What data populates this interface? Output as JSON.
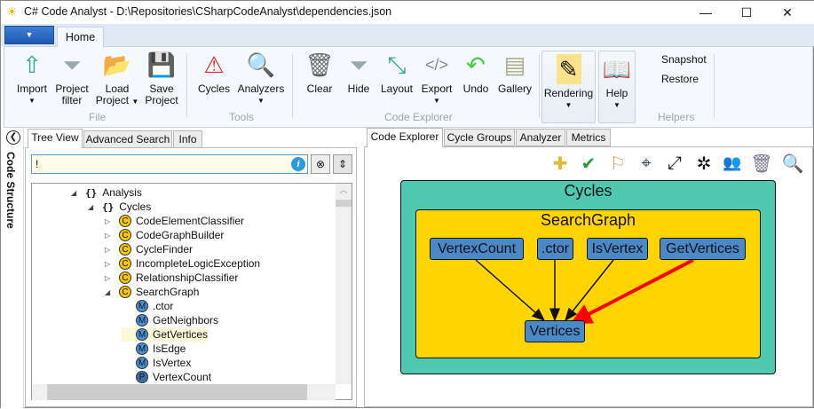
{
  "window": {
    "title": "C# Code Analyst - D:\\Repositories\\CSharpCodeAnalyst\\dependencies.json",
    "minimize": "—",
    "maximize": "☐",
    "close": "✕"
  },
  "ribbon": {
    "app_menu": "▼",
    "tab": "Home",
    "file": {
      "label": "File",
      "import": "Import",
      "project_filter_1": "Project",
      "project_filter_2": "filter",
      "load_1": "Load",
      "load_2": "Project",
      "save_1": "Save",
      "save_2": "Project"
    },
    "tools": {
      "label": "Tools",
      "cycles": "Cycles",
      "analyzers": "Analyzers"
    },
    "explorer": {
      "label": "Code Explorer",
      "clear": "Clear",
      "hide": "Hide",
      "layout": "Layout",
      "export": "Export",
      "undo": "Undo",
      "gallery": "Gallery"
    },
    "rendering": "Rendering",
    "help": "Help",
    "helpers": {
      "label": "Helpers",
      "snapshot": "Snapshot",
      "restore": "Restore"
    }
  },
  "left": {
    "strip_label": "Code Structure",
    "tabs": [
      "Tree View",
      "Advanced Search",
      "Info"
    ],
    "search_value": "!",
    "tree": [
      {
        "label": "Analysis",
        "kind": "ns",
        "level": 0,
        "expanded": true
      },
      {
        "label": "Cycles",
        "kind": "ns",
        "level": 1,
        "expanded": true
      },
      {
        "label": "CodeElementClassifier",
        "kind": "C",
        "level": 2,
        "expanded": false
      },
      {
        "label": "CodeGraphBuilder",
        "kind": "C",
        "level": 2,
        "expanded": false
      },
      {
        "label": "CycleFinder",
        "kind": "C",
        "level": 2,
        "expanded": false
      },
      {
        "label": "IncompleteLogicException",
        "kind": "C",
        "level": 2,
        "expanded": false
      },
      {
        "label": "RelationshipClassifier",
        "kind": "C",
        "level": 2,
        "expanded": false
      },
      {
        "label": "SearchGraph",
        "kind": "C",
        "level": 2,
        "expanded": true
      },
      {
        "label": ".ctor",
        "kind": "M",
        "level": 3
      },
      {
        "label": "GetNeighbors",
        "kind": "M",
        "level": 3
      },
      {
        "label": "GetVertices",
        "kind": "M",
        "level": 3,
        "highlighted": true
      },
      {
        "label": "IsEdge",
        "kind": "M",
        "level": 3
      },
      {
        "label": "IsVertex",
        "kind": "M",
        "level": 3
      },
      {
        "label": "VertexCount",
        "kind": "P",
        "level": 3
      }
    ]
  },
  "right": {
    "tabs": [
      "Code Explorer",
      "Cycle Groups",
      "Analyzer",
      "Metrics"
    ],
    "toolbar": [
      "puzzle-icon",
      "refresh-check-icon",
      "flag-icon",
      "target-icon",
      "expand-icon",
      "collapse-icon",
      "users-add-icon",
      "trash-icon",
      "search-icon"
    ],
    "graph": {
      "outer": "Cycles",
      "inner": "SearchGraph",
      "nodes": {
        "vertex_count": "VertexCount",
        "ctor": ".ctor",
        "is_vertex": "IsVertex",
        "get_vertices": "GetVertices",
        "vertices": "Vertices"
      },
      "colors": {
        "outer": "#4fc8b0",
        "inner": "#ffd400",
        "node": "#4a89c8",
        "highlight_edge": "#ff0000"
      }
    }
  }
}
